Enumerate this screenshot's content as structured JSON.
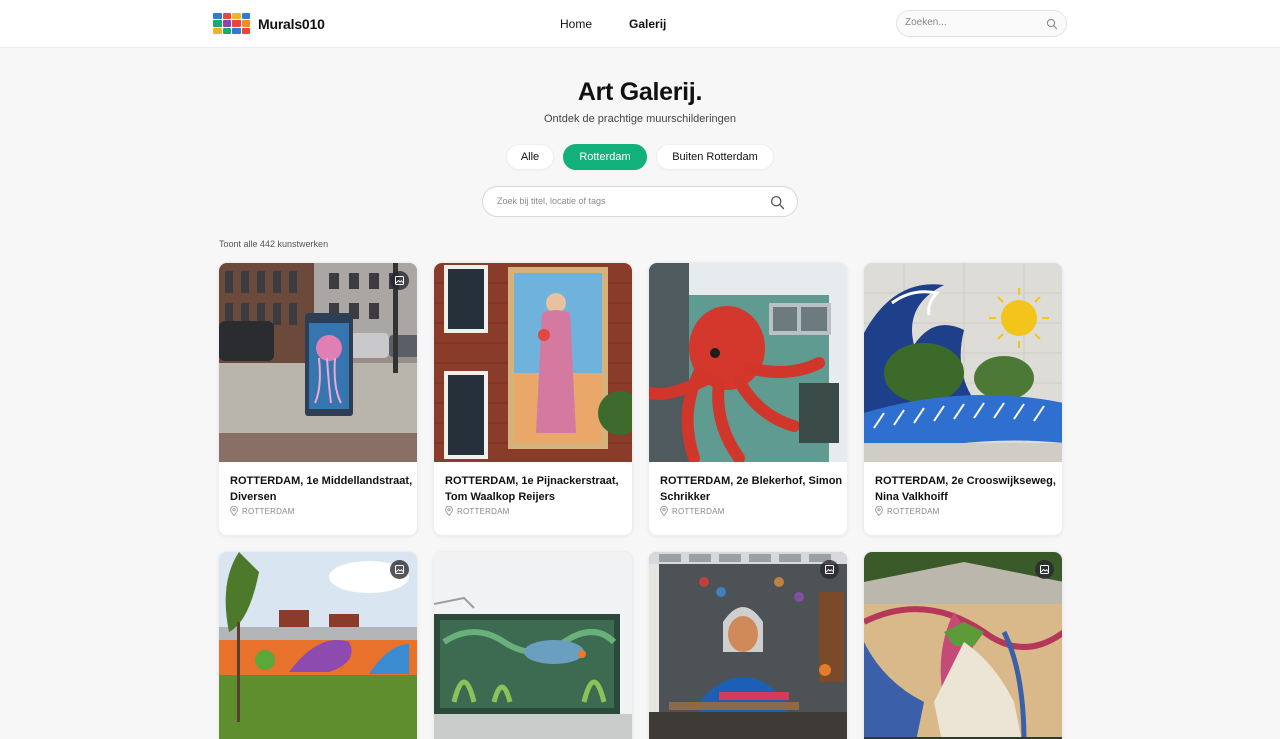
{
  "header": {
    "logo_text": "Murals010",
    "nav": [
      {
        "label": "Home",
        "active": false
      },
      {
        "label": "Galerij",
        "active": true
      }
    ],
    "search_placeholder": "Zoeken..."
  },
  "hero": {
    "title": "Art Galerij.",
    "subtitle": "Ontdek de prachtige muurschilderingen"
  },
  "filters": [
    {
      "label": "Alle",
      "active": false
    },
    {
      "label": "Rotterdam",
      "active": true
    },
    {
      "label": "Buiten Rotterdam",
      "active": false
    }
  ],
  "search": {
    "placeholder": "Zoek bij titel, locatie of tags"
  },
  "result_count": "Toont alle 442 kunstwerken",
  "colors": {
    "accent": "#12b07a"
  },
  "cards": [
    {
      "title": "ROTTERDAM, 1e Middellandstraat, Diversen",
      "location": "ROTTERDAM",
      "badge_icon": "gallery-icon",
      "has_badge": true
    },
    {
      "title": "ROTTERDAM, 1e Pijnackerstraat, Tom Waalkop Reijers",
      "location": "ROTTERDAM",
      "badge_icon": "gallery-icon",
      "has_badge": false
    },
    {
      "title": "ROTTERDAM, 2e Blekerhof, Simon Schrikker",
      "location": "ROTTERDAM",
      "badge_icon": "gallery-icon",
      "has_badge": false
    },
    {
      "title": "ROTTERDAM, 2e Crooswijkseweg, Nina Valkhoiff",
      "location": "ROTTERDAM",
      "badge_icon": "gallery-icon",
      "has_badge": false
    },
    {
      "title": "",
      "location": "",
      "badge_icon": "gallery-icon",
      "has_badge": true
    },
    {
      "title": "",
      "location": "",
      "badge_icon": "gallery-icon",
      "has_badge": false
    },
    {
      "title": "",
      "location": "",
      "badge_icon": "gallery-icon",
      "has_badge": true
    },
    {
      "title": "",
      "location": "",
      "badge_icon": "gallery-icon",
      "has_badge": true
    }
  ]
}
